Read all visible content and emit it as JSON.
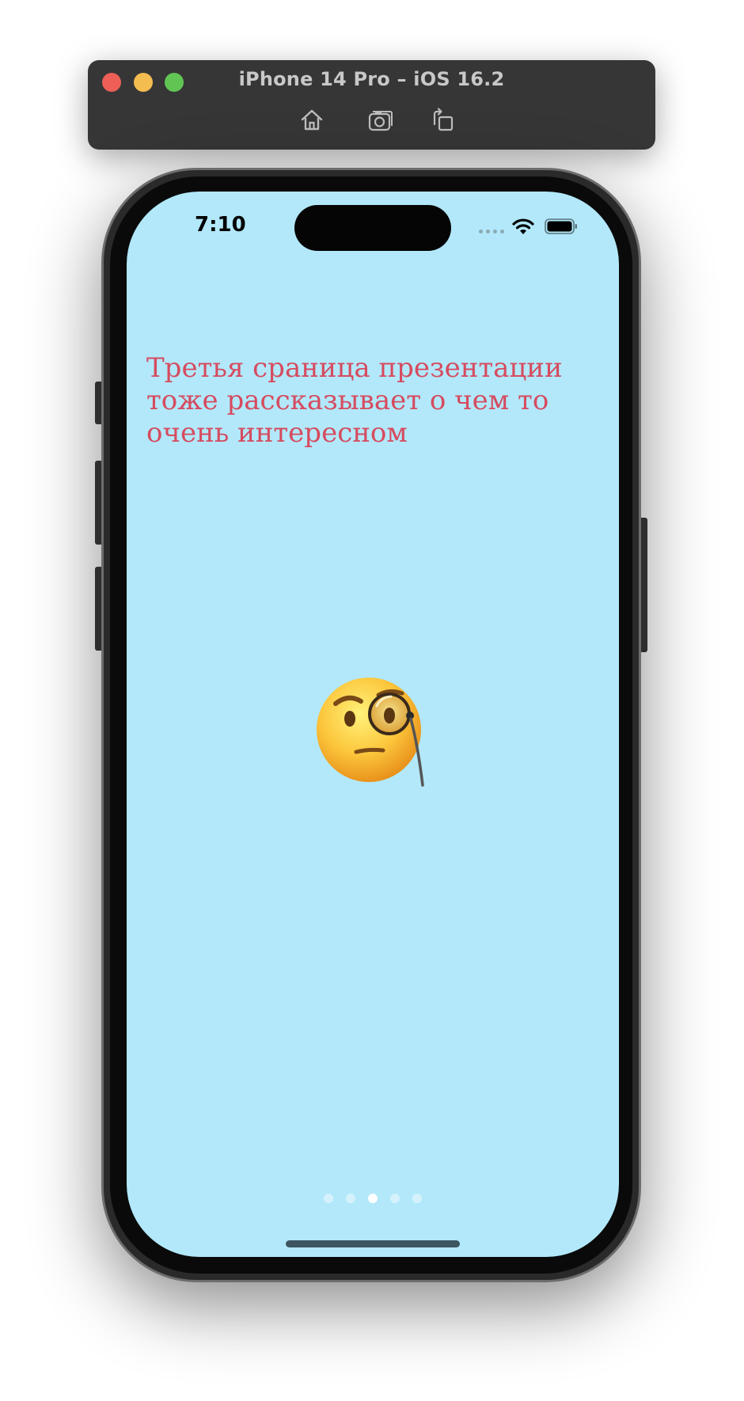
{
  "simulator": {
    "title": "iPhone 14 Pro – iOS 16.2",
    "tools": [
      "home-icon",
      "screenshot-icon",
      "rotate-icon"
    ]
  },
  "status_bar": {
    "time": "7:10"
  },
  "content": {
    "headline": "Третья сраница презентации тоже рассказывает о чем то очень интересном",
    "emoji_icon": "face-with-monocle-icon"
  },
  "page_control": {
    "total_pages": 5,
    "current_page": 3
  },
  "colors": {
    "screen_background": "#b2e8fa",
    "headline_text": "#d64b5f"
  }
}
